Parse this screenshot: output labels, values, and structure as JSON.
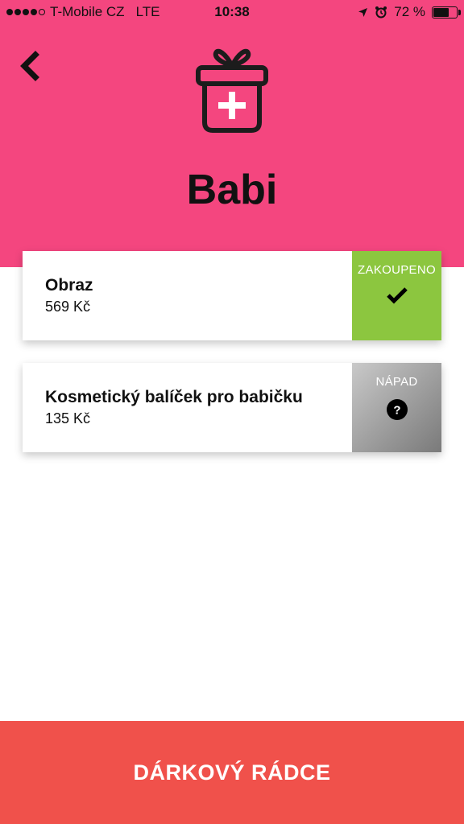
{
  "status_bar": {
    "carrier": "T-Mobile CZ",
    "network": "LTE",
    "time": "10:38",
    "battery_percent": "72 %",
    "battery_level": 0.72
  },
  "header": {
    "title": "Babi",
    "accent_color": "#f4467f"
  },
  "gifts": [
    {
      "name": "Obraz",
      "price": "569 Kč",
      "status_label": "ZAKOUPENO",
      "status_icon": "checkmark-icon",
      "status_color": "#8cc63f"
    },
    {
      "name": "Kosmetický balíček pro babičku",
      "price": "135 Kč",
      "status_label": "NÁPAD",
      "status_icon": "question-icon",
      "status_color": "#9d9d9d"
    }
  ],
  "footer": {
    "button_label": "DÁRKOVÝ RÁDCE",
    "button_color": "#f0514b"
  }
}
